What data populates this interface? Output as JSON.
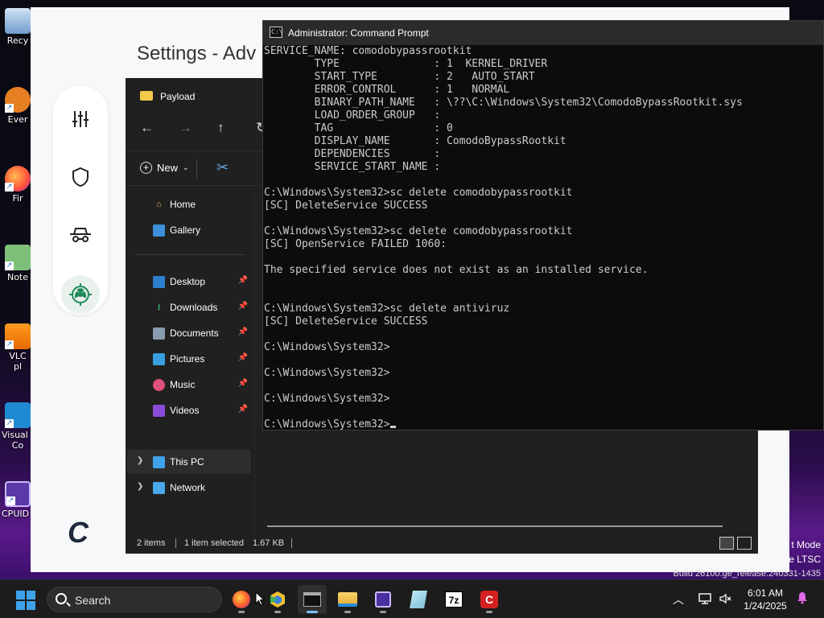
{
  "desktop": {
    "icons": [
      {
        "label": "Recy",
        "name": "recycle-bin-icon"
      },
      {
        "label": "Ever",
        "name": "everything-icon"
      },
      {
        "label": "Fir",
        "name": "firefox-icon"
      },
      {
        "label": "Note",
        "name": "notepad-icon"
      },
      {
        "label": "VLC",
        "label2": "pl",
        "name": "vlc-icon"
      },
      {
        "label": "Visual S",
        "label2": "Co",
        "name": "vscode-icon"
      },
      {
        "label": "CPUID C",
        "name": "cpuid-icon"
      }
    ]
  },
  "settings": {
    "title": "Settings - Adv"
  },
  "explorer": {
    "title": "Payload",
    "new_label": "New",
    "nav": {
      "home": "Home",
      "gallery": "Gallery",
      "desktop": "Desktop",
      "downloads": "Downloads",
      "documents": "Documents",
      "pictures": "Pictures",
      "music": "Music",
      "videos": "Videos",
      "this_pc": "This PC",
      "network": "Network"
    },
    "status": {
      "items": "2 items",
      "selected": "1 item selected",
      "size": "1.67 KB"
    }
  },
  "cmd": {
    "title": "Administrator: Command Prompt",
    "lines": [
      "SERVICE_NAME: comodobypassrootkit",
      "        TYPE               : 1  KERNEL_DRIVER",
      "        START_TYPE         : 2   AUTO_START",
      "        ERROR_CONTROL      : 1   NORMAL",
      "        BINARY_PATH_NAME   : \\??\\C:\\Windows\\System32\\ComodoBypassRootkit.sys",
      "        LOAD_ORDER_GROUP   :",
      "        TAG                : 0",
      "        DISPLAY_NAME       : ComodoBypassRootkit",
      "        DEPENDENCIES       :",
      "        SERVICE_START_NAME :",
      "",
      "C:\\Windows\\System32>sc delete comodobypassrootkit",
      "[SC] DeleteService SUCCESS",
      "",
      "C:\\Windows\\System32>sc delete comodobypassrootkit",
      "[SC] OpenService FAILED 1060:",
      "",
      "The specified service does not exist as an installed service.",
      "",
      "",
      "C:\\Windows\\System32>sc delete antiviruz",
      "[SC] DeleteService SUCCESS",
      "",
      "C:\\Windows\\System32>",
      "",
      "C:\\Windows\\System32>",
      "",
      "C:\\Windows\\System32>",
      "",
      "C:\\Windows\\System32>"
    ]
  },
  "watermark": {
    "line1": "t Mode",
    "line2": "se LTSC",
    "line3": "Build 26100.ge_release.240331-1435"
  },
  "taskbar": {
    "search_placeholder": "Search",
    "time": "6:01 AM",
    "date": "1/24/2025",
    "apps": [
      "firefox",
      "chromium",
      "terminal",
      "file-explorer",
      "cpuid",
      "notepad",
      "7zip",
      "comodo"
    ]
  }
}
